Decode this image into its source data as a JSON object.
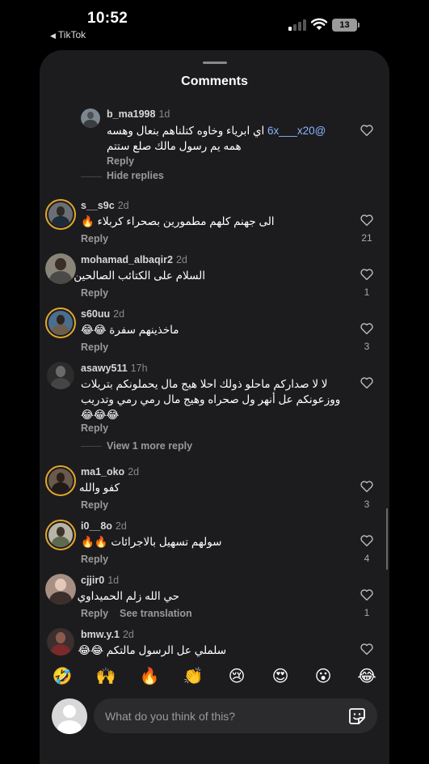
{
  "status_bar": {
    "time": "10:52",
    "back_app": "TikTok",
    "battery": "13"
  },
  "sheet": {
    "title": "Comments"
  },
  "reply_label": "Reply",
  "reply_thread": {
    "username": "b_ma1998",
    "time": "1d",
    "mention": "@6x___x20",
    "text_line1": "اي ابرياء وخاوه كتلناهم بنعال وهسه",
    "text_line2": "همه يم رسول مالك صلع ستتم",
    "hide_replies": "Hide replies"
  },
  "comments": [
    {
      "username": "s__s9c",
      "time": "2d",
      "text": "الى جهنم  كلهم مطمورين بصحراء كربلاء 🔥",
      "likes": "21"
    },
    {
      "username": "mohamad_albaqir2",
      "time": "2d",
      "text": "السلام على الكتائب الصالحين",
      "likes": "1"
    },
    {
      "username": "s60uu",
      "time": "2d",
      "text": "ماخذينهم سفرة 😂😂",
      "likes": "3"
    },
    {
      "username": "asawy511",
      "time": "17h",
      "text": "لا لا  صداركم ماحلو ذولك احلا هيج مال يحملونكم  بتريلات ووزعونكم عل أنهر ول صحراه وهيج مال رمي رمي وتدريب 😂😂😂",
      "likes": ""
    },
    {
      "username": "ma1_oko",
      "time": "2d",
      "text": "كفو والله",
      "likes": "3"
    },
    {
      "username": "i0__8o",
      "time": "2d",
      "text": "سولهم تسهيل بالاجرائات 🔥🔥",
      "likes": "4"
    },
    {
      "username": "cjjir0",
      "time": "1d",
      "text": "حي الله زلم الحميداوي",
      "likes": "1"
    },
    {
      "username": "bmw.y.1",
      "time": "2d",
      "text": "سلملي عل الرسول مالتكم 😂😂",
      "likes": ""
    }
  ],
  "view_more": "View 1 more reply",
  "see_translation": "See translation",
  "emojis": [
    "🤣",
    "🙌",
    "🔥",
    "👏",
    "😢",
    "😍",
    "😮",
    "😂"
  ],
  "composer": {
    "placeholder": "What do you think of this?"
  },
  "icons": {
    "heart": "heart-icon",
    "sticker": "sticker-icon",
    "signal": "cell-signal-icon",
    "wifi": "wifi-icon",
    "battery": "battery-icon"
  }
}
